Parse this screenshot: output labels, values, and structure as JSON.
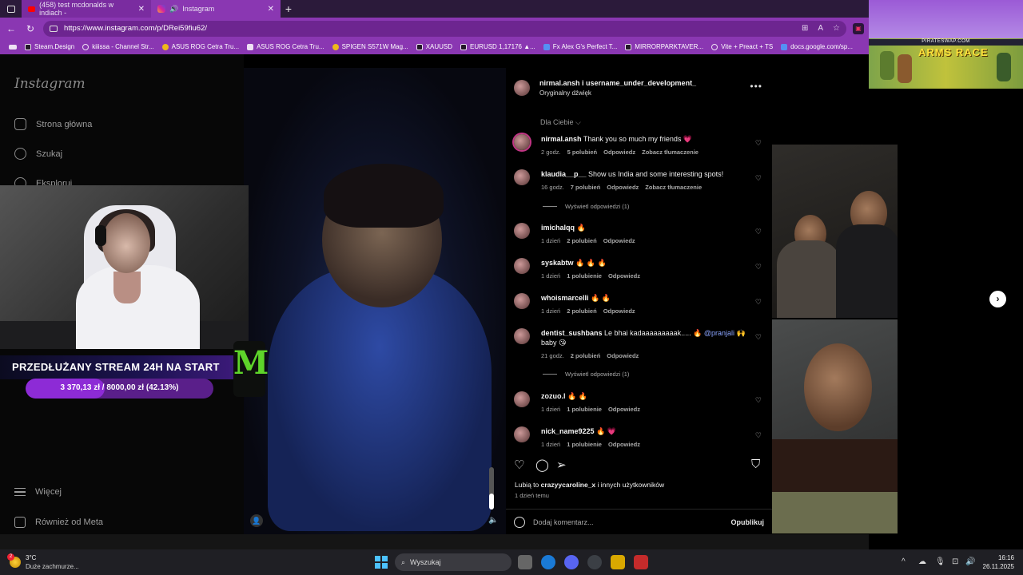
{
  "browser": {
    "tabs": [
      {
        "title": "(458) test mcdonalds w indiach -",
        "type": "youtube"
      },
      {
        "title": "Instagram",
        "type": "instagram"
      }
    ],
    "url": "https://www.instagram.com/p/DRei59fiu62/",
    "bookmarks": [
      "Steam.Design",
      "kiiissa - Channel Str...",
      "ASUS ROG Cetra Tru...",
      "ASUS ROG Cetra Tru...",
      "SPIGEN S571W Mag...",
      "XAUUSD",
      "EURUSD 1,17176 ▲...",
      "Fx Alex G's Perfect T...",
      "MIRRORPARKTAVER...",
      "Vite + Preact + TS",
      "docs.google.com/sp..."
    ]
  },
  "ad": {
    "site": "PIRATESWAP.COM",
    "title": "ARMS RACE"
  },
  "instagram": {
    "logo": "Instagram",
    "nav": {
      "home": "Strona główna",
      "search": "Szukaj",
      "explore": "Eksploruj",
      "more": "Więcej",
      "meta": "Również od Meta"
    },
    "post": {
      "authors": "nirmal.ansh i username_under_development_",
      "audio": "Oryginalny dźwięk",
      "sort": "Dla Ciebie",
      "likes_prefix": "Lubią to",
      "likes_user": "crazyycaroline_x",
      "likes_suffix": "i innych użytkowników",
      "time": "1 dzień temu",
      "comment_placeholder": "Dodaj komentarz...",
      "publish": "Opublikuj"
    },
    "comments": [
      {
        "user": "nirmal.ansh",
        "text": "Thank you so much my friends 💗",
        "time": "2 godz.",
        "likes": "5 polubień",
        "reply": "Odpowiedz",
        "translate": "Zobacz tłumaczenie"
      },
      {
        "user": "klaudia__p__",
        "text": "Show us India and some interesting spots!",
        "time": "16 godz.",
        "likes": "7 polubień",
        "reply": "Odpowiedz",
        "translate": "Zobacz tłumaczenie",
        "replies": "Wyświetl odpowiedzi (1)"
      },
      {
        "user": "imichalqq",
        "text": "🔥",
        "time": "1 dzień",
        "likes": "2 polubień",
        "reply": "Odpowiedz"
      },
      {
        "user": "syskabtw",
        "text": "🔥 🔥 🔥",
        "time": "1 dzień",
        "likes": "1 polubienie",
        "reply": "Odpowiedz"
      },
      {
        "user": "whoismarcelli",
        "text": "🔥 🔥",
        "time": "1 dzień",
        "likes": "2 polubień",
        "reply": "Odpowiedz"
      },
      {
        "user": "dentist_sushbans",
        "text": "Le bhai kadaaaaaaaaak..... 🔥",
        "mention": "@pranjali",
        "text2": "🙌 baby 😘",
        "time": "21 godz.",
        "likes": "2 polubień",
        "reply": "Odpowiedz",
        "replies": "Wyświetl odpowiedzi (1)"
      },
      {
        "user": "zozuo.l",
        "text": "🔥 🔥",
        "time": "1 dzień",
        "likes": "1 polubienie",
        "reply": "Odpowiedz"
      },
      {
        "user": "nick_name9225",
        "text": "🔥 💗",
        "time": "1 dzień",
        "likes": "1 polubienie",
        "reply": "Odpowiedz"
      }
    ]
  },
  "stream": {
    "title": "PRZEDŁUŻANY STREAM 24H NA START",
    "goal_text": "3 370,13 zł / 8000,00 zł (42.13%)",
    "goal_fraction": 0.4213,
    "sponsor_letter": "M"
  },
  "taskbar": {
    "temp": "3°C",
    "weather": "Duże zachmurze...",
    "weather_badge": "2",
    "search": "Wyszukaj",
    "time": "16:16",
    "date": "26.11.2025"
  },
  "colors": {
    "browser_accent": "#8a37b2",
    "goal_fill": "#8d2bd6",
    "monster_green": "#5ed42a",
    "mention": "#8aa4ff"
  }
}
